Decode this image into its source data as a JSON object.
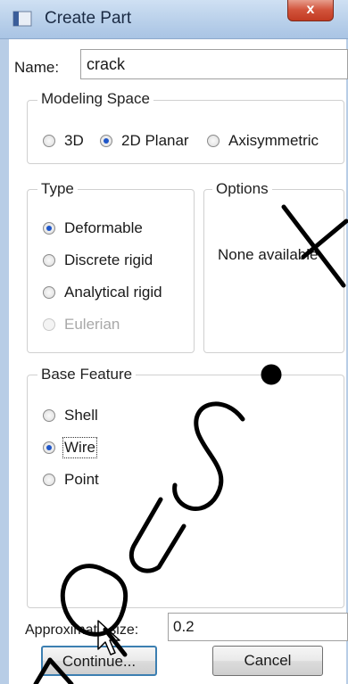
{
  "window": {
    "title": "Create Part",
    "close_label": "x"
  },
  "name": {
    "label": "Name:",
    "value": "crack"
  },
  "modeling_space": {
    "title": "Modeling Space",
    "options": [
      {
        "label": "3D",
        "selected": false
      },
      {
        "label": "2D Planar",
        "selected": true
      },
      {
        "label": "Axisymmetric",
        "selected": false
      }
    ]
  },
  "type": {
    "title": "Type",
    "options": [
      {
        "label": "Deformable",
        "selected": true,
        "enabled": true
      },
      {
        "label": "Discrete rigid",
        "selected": false,
        "enabled": true
      },
      {
        "label": "Analytical rigid",
        "selected": false,
        "enabled": true
      },
      {
        "label": "Eulerian",
        "selected": false,
        "enabled": false
      }
    ]
  },
  "options_group": {
    "title": "Options",
    "message": "None available"
  },
  "base_feature": {
    "title": "Base Feature",
    "options": [
      {
        "label": "Shell",
        "selected": false
      },
      {
        "label": "Wire",
        "selected": true
      },
      {
        "label": "Point",
        "selected": false
      }
    ]
  },
  "approx_size": {
    "label": "Approximate size:",
    "value": "0.2"
  },
  "buttons": {
    "continue_label": "Continue...",
    "cancel_label": "Cancel"
  },
  "colors": {
    "accent": "#1f56c8",
    "titlebar": "#b9d0ea",
    "close": "#c23b22"
  }
}
